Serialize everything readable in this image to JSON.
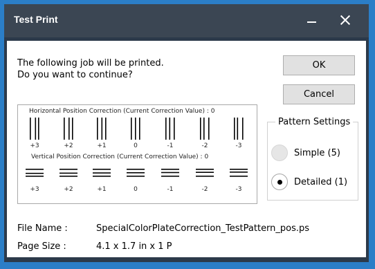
{
  "window": {
    "title": "Test Print"
  },
  "message": {
    "text": "The following job will be printed.\nDo you want to continue?"
  },
  "buttons": {
    "ok": "OK",
    "cancel": "Cancel"
  },
  "preview": {
    "horizontal_title": "Horizontal Position Correction (Current Correction Value) :  0",
    "vertical_title": "Vertical Position Correction (Current Correction Value) :  0",
    "horizontal_labels": [
      "+3",
      "+2",
      "+1",
      "0",
      "-1",
      "-2",
      "-3"
    ],
    "vertical_labels": [
      "+3",
      "+2",
      "+1",
      "0",
      "-1",
      "-2",
      "-3"
    ]
  },
  "pattern_settings": {
    "title": "Pattern Settings",
    "options": [
      {
        "label": "Simple (5)",
        "selected": false
      },
      {
        "label": "Detailed (1)",
        "selected": true
      }
    ]
  },
  "info": {
    "file_name_label": "File Name :",
    "file_name_value": "SpecialColorPlateCorrection_TestPattern_pos.ps",
    "page_size_label": "Page Size :",
    "page_size_value": "4.1 x 1.7 in x 1 P"
  }
}
